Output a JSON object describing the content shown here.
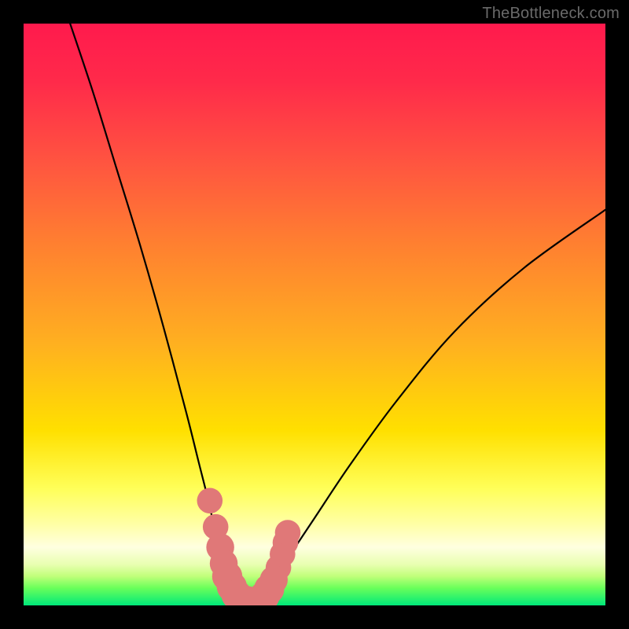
{
  "watermark": {
    "text": "TheBottleneck.com"
  },
  "chart_data": {
    "type": "line",
    "title": "",
    "xlabel": "",
    "ylabel": "",
    "x_range": [
      0,
      100
    ],
    "y_range": [
      0,
      100
    ],
    "curve_left": {
      "name": "left-branch",
      "x": [
        8,
        12,
        16,
        20,
        24,
        28,
        30,
        32,
        33,
        34,
        34.5,
        35,
        36,
        37,
        38
      ],
      "y": [
        100,
        88,
        75,
        62,
        48,
        33,
        25,
        17,
        12,
        8,
        6,
        4,
        2,
        1,
        0
      ]
    },
    "curve_right": {
      "name": "right-branch",
      "x": [
        40,
        41,
        42,
        43,
        44,
        46,
        50,
        56,
        64,
        74,
        86,
        100
      ],
      "y": [
        0,
        1,
        2,
        4,
        6,
        9,
        15,
        24,
        35,
        47,
        58,
        68
      ]
    },
    "valley_floor": {
      "name": "valley-floor",
      "x": [
        35,
        40
      ],
      "y": [
        0,
        0
      ]
    },
    "overlay_dots": {
      "name": "salmon-dots",
      "color": "#e07878",
      "points": [
        {
          "x": 32.0,
          "y": 18.0,
          "r": 2.2
        },
        {
          "x": 33.0,
          "y": 13.5,
          "r": 2.2
        },
        {
          "x": 33.8,
          "y": 10.0,
          "r": 2.4
        },
        {
          "x": 34.4,
          "y": 7.2,
          "r": 2.4
        },
        {
          "x": 35.0,
          "y": 5.0,
          "r": 2.6
        },
        {
          "x": 35.8,
          "y": 3.2,
          "r": 2.6
        },
        {
          "x": 36.6,
          "y": 1.8,
          "r": 2.6
        },
        {
          "x": 37.6,
          "y": 1.0,
          "r": 2.6
        },
        {
          "x": 38.6,
          "y": 0.7,
          "r": 2.6
        },
        {
          "x": 39.6,
          "y": 0.6,
          "r": 2.6
        },
        {
          "x": 40.6,
          "y": 0.9,
          "r": 2.6
        },
        {
          "x": 41.4,
          "y": 1.6,
          "r": 2.6
        },
        {
          "x": 42.2,
          "y": 2.8,
          "r": 2.6
        },
        {
          "x": 43.0,
          "y": 4.4,
          "r": 2.4
        },
        {
          "x": 43.8,
          "y": 6.5,
          "r": 2.2
        },
        {
          "x": 44.5,
          "y": 8.8,
          "r": 2.2
        },
        {
          "x": 45.0,
          "y": 10.8,
          "r": 2.2
        },
        {
          "x": 45.4,
          "y": 12.5,
          "r": 2.2
        }
      ]
    }
  }
}
